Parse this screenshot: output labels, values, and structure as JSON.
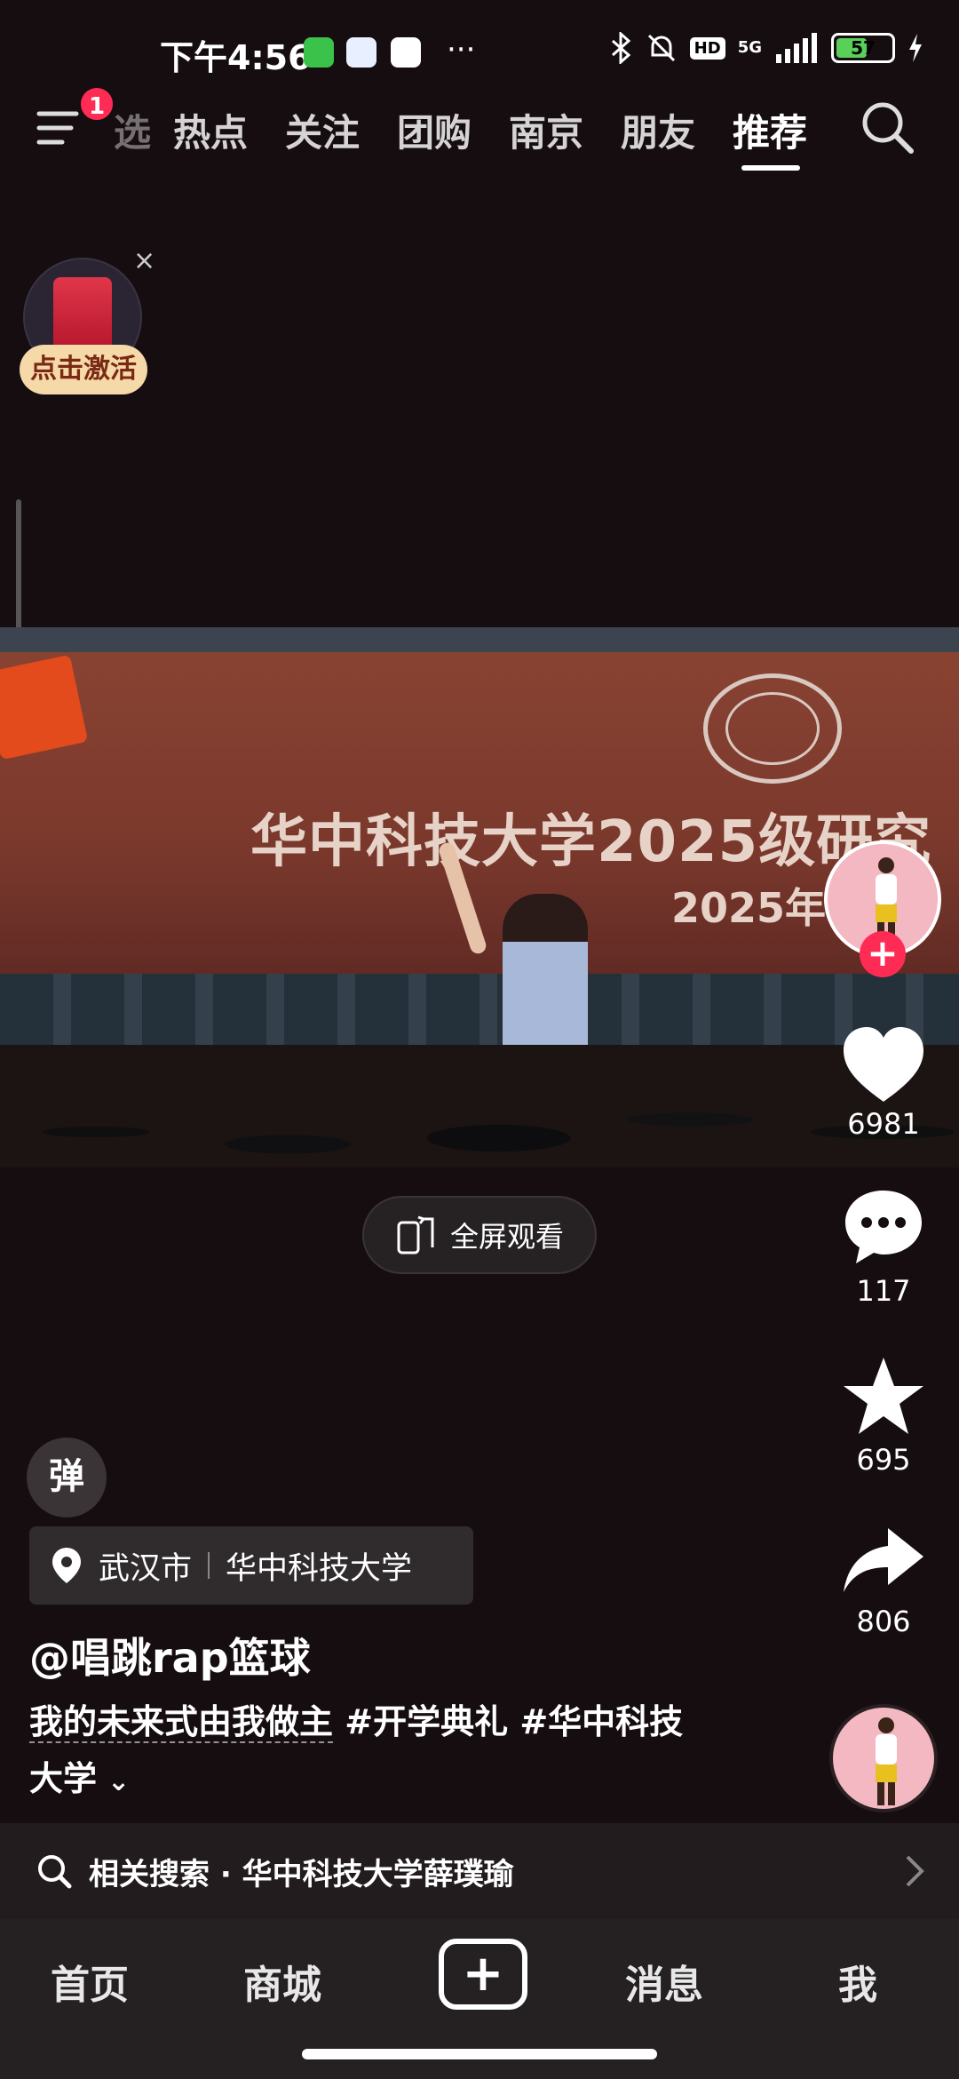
{
  "status_bar": {
    "time": "下午4:56",
    "more": "···",
    "hd": "HD",
    "network": "5G",
    "battery": "57",
    "battery_level": 0.57
  },
  "top_nav": {
    "menu_badge": "1",
    "tabs": [
      "热点",
      "关注",
      "团购",
      "南京",
      "朋友",
      "推荐"
    ],
    "active_tab": "推荐",
    "partial_tab": "选"
  },
  "red_packet": {
    "close": "×",
    "label": "点击激活"
  },
  "video": {
    "stage_text_line1": "华中科技大学2025级研究",
    "stage_text_line2": "2025年"
  },
  "right_rail": {
    "likes": "6981",
    "comments": "117",
    "favorites": "695",
    "shares": "806",
    "follow": "+"
  },
  "fullscreen": {
    "label": "全屏观看"
  },
  "danmu": {
    "label": "弹"
  },
  "location": {
    "city": "武汉市",
    "place": "华中科技大学"
  },
  "post": {
    "author": "@唱跳rap篮球",
    "caption_main": "我的未来式由我做主",
    "hashtag1": "#开学典礼",
    "hashtag2": "#华中科技",
    "caption_wrap": "大学"
  },
  "related_search": {
    "label": "相关搜索 · 华中科技大学薛璞瑜"
  },
  "bottom_nav": {
    "home": "首页",
    "mall": "商城",
    "add": "+",
    "messages": "消息",
    "me": "我"
  },
  "colors": {
    "background": "#160d10",
    "accent": "#fe2c55",
    "nav_bar": "#252022"
  }
}
